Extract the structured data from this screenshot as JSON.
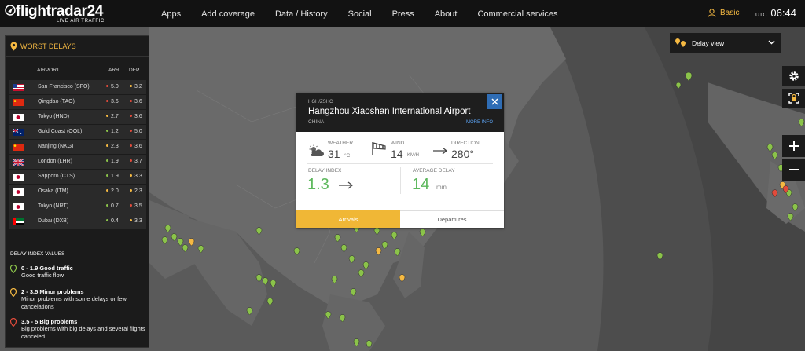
{
  "header": {
    "logo_text": "flightradar24",
    "logo_tagline": "LIVE AIR TRAFFIC",
    "nav": [
      "Apps",
      "Add coverage",
      "Data / History",
      "Social",
      "Press",
      "About",
      "Commercial services"
    ],
    "account_label": "Basic",
    "utc_label": "UTC",
    "time": "06:44"
  },
  "delays_panel": {
    "title": "WORST DELAYS",
    "col_airport": "AIRPORT",
    "col_arr": "ARR.",
    "col_dep": "DEP.",
    "rows": [
      {
        "airport": "San Francisco (SFO)",
        "arr": "5.0",
        "dep": "3.2",
        "arr_level": "red",
        "dep_level": "yellow",
        "flag": "us"
      },
      {
        "airport": "Qingdao (TAO)",
        "arr": "3.6",
        "dep": "3.6",
        "arr_level": "red",
        "dep_level": "red",
        "flag": "cn"
      },
      {
        "airport": "Tokyo (HND)",
        "arr": "2.7",
        "dep": "3.6",
        "arr_level": "yellow",
        "dep_level": "red",
        "flag": "jp"
      },
      {
        "airport": "Gold Coast (OOL)",
        "arr": "1.2",
        "dep": "5.0",
        "arr_level": "green",
        "dep_level": "red",
        "flag": "au"
      },
      {
        "airport": "Nanjing (NKG)",
        "arr": "2.3",
        "dep": "3.6",
        "arr_level": "yellow",
        "dep_level": "red",
        "flag": "cn"
      },
      {
        "airport": "London (LHR)",
        "arr": "1.9",
        "dep": "3.7",
        "arr_level": "green",
        "dep_level": "red",
        "flag": "gb"
      },
      {
        "airport": "Sapporo (CTS)",
        "arr": "1.9",
        "dep": "3.3",
        "arr_level": "green",
        "dep_level": "yellow",
        "flag": "jp"
      },
      {
        "airport": "Osaka (ITM)",
        "arr": "2.0",
        "dep": "2.3",
        "arr_level": "yellow",
        "dep_level": "yellow",
        "flag": "jp"
      },
      {
        "airport": "Tokyo (NRT)",
        "arr": "0.7",
        "dep": "3.5",
        "arr_level": "green",
        "dep_level": "red",
        "flag": "jp"
      },
      {
        "airport": "Dubai (DXB)",
        "arr": "0.4",
        "dep": "3.3",
        "arr_level": "green",
        "dep_level": "yellow",
        "flag": "ae"
      }
    ],
    "legend_title": "DELAY INDEX VALUES",
    "legend": [
      {
        "range": "0 - 1.9 Good traffic",
        "desc": "Good traffic flow",
        "color": "#8bc34a"
      },
      {
        "range": "2 - 3.5 Minor problems",
        "desc": "Minor problems with some delays or few cancelations",
        "color": "#f5b942"
      },
      {
        "range": "3.5 - 5 Big problems",
        "desc": "Big problems with big delays and several flights canceled.",
        "color": "#e14b3b"
      }
    ]
  },
  "delay_view": {
    "label": "Delay view"
  },
  "airport_card": {
    "code": "HGH/ZSHC",
    "name": "Hangzhou Xiaoshan International Airport",
    "country": "CHINA",
    "more_info": "MORE INFO",
    "weather_label": "WEATHER",
    "temperature": "31",
    "temp_unit": "°C",
    "wind_label": "WIND",
    "wind_speed": "14",
    "wind_unit": "KM/H",
    "direction_label": "DIRECTION",
    "direction": "280°",
    "delay_index_label": "DELAY INDEX",
    "delay_index": "1.3",
    "avg_delay_label": "AVERAGE DELAY",
    "avg_delay": "14",
    "avg_delay_unit": "min",
    "tab_arrivals": "Arrivals",
    "tab_departures": "Departures"
  },
  "colors": {
    "accent": "#f5b942",
    "good": "#8bc34a",
    "minor": "#f5b942",
    "big": "#e14b3b",
    "link": "#2f6db5"
  }
}
